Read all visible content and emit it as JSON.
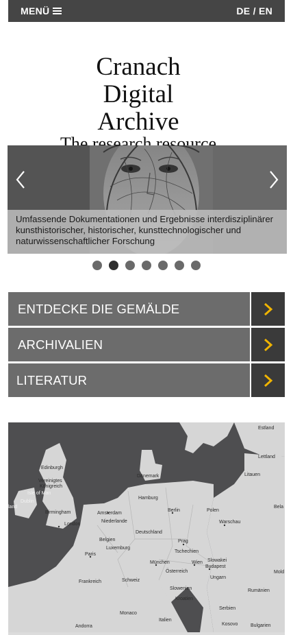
{
  "header": {
    "menu_label": "MENÜ",
    "language_label": "DE / EN"
  },
  "site": {
    "title": "Cranach Digital Archive",
    "subtitle": "The research resource"
  },
  "slider": {
    "caption": "Umfassende Dokumentationen und Ergebnisse interdisziplinärer kunsthistorischer, historischer, kunsttechnologischer und naturwissenschaftlicher Forschung",
    "slide_count": 7,
    "active_index": 1
  },
  "nav": {
    "items": [
      {
        "label": "ENTDECKE DIE GEMÄLDE"
      },
      {
        "label": "ARCHIVALIEN"
      },
      {
        "label": "LITERATUR"
      }
    ]
  },
  "map": {
    "labels": {
      "estland": "Estland",
      "lettland": "Lettland",
      "litauen": "Litauen",
      "daenemark": "Dänemark",
      "edinburgh": "Edinburgh",
      "vereinigtes": "Vereinigtes",
      "koenigreich": "Königreich",
      "isle_of_man": "Isle of Man",
      "dublin": "Dublin",
      "land": "land",
      "birmingham": "Birmingham",
      "london": "London",
      "amsterdam": "Amsterdam",
      "niederlande": "Niederlande",
      "hamburg": "Hamburg",
      "berlin": "Berlin",
      "polen": "Polen",
      "warschau": "Warschau",
      "deutschland": "Deutschland",
      "belgien": "Belgien",
      "luxemburg": "Luxemburg",
      "prag": "Prag",
      "tschechien": "Tschechien",
      "paris": "Paris",
      "slowakei": "Slowakei",
      "muenchen": "München",
      "wien": "Wien",
      "oesterreich": "Österreich",
      "ungarn": "Ungarn",
      "budapest": "Budapest",
      "frankreich": "Frankreich",
      "schweiz": "Schweiz",
      "slowenien": "Slowenien",
      "kroatien": "Kroatien",
      "rumaenien": "Rumänien",
      "serbien": "Serbien",
      "monaco": "Monaco",
      "italien": "Italien",
      "andorra": "Andorra",
      "kosovo": "Kosovo",
      "bulgarien": "Bulgarien",
      "bela": "Bela",
      "mold": "Mold"
    }
  }
}
